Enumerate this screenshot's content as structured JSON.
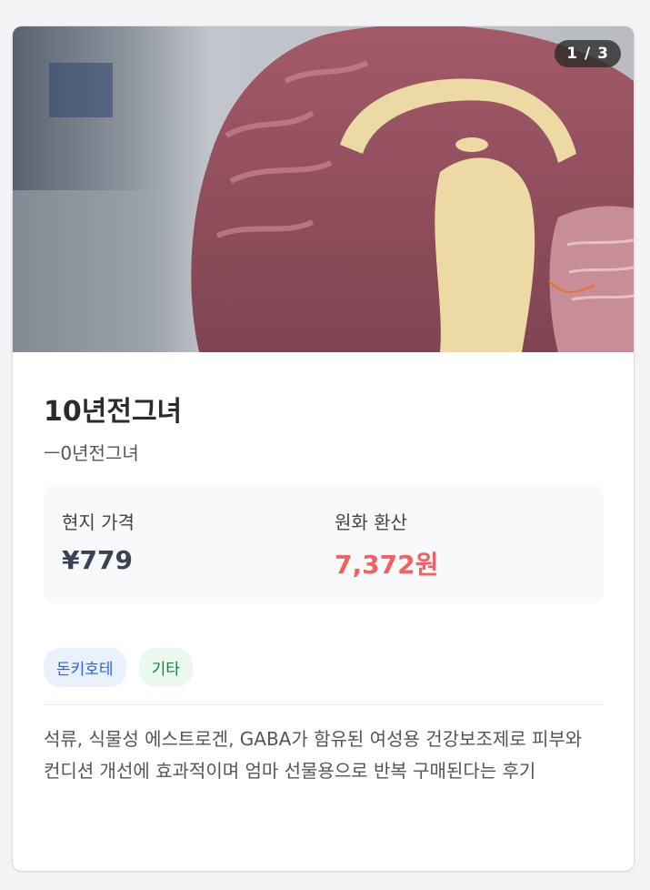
{
  "carousel": {
    "counter": "1 / 3"
  },
  "product": {
    "title": "10년전그녀",
    "subtitle": "ㅡ0년전그녀",
    "local_price_label": "현지 가격",
    "local_price": "¥779",
    "converted_label": "원화 환산",
    "converted_price": "7,372원",
    "tags": [
      "돈키호테",
      "기타"
    ],
    "description": "석류, 식물성 에스트로겐, GABA가 함유된 여성용 건강보조제로 피부와 컨디션 개선에 효과적이며 엄마 선물용으로 반복 구매된다는 후기"
  },
  "colors": {
    "converted_price": "#f06262",
    "store_tag_bg": "#e9f1ff",
    "store_tag_text": "#2563eb",
    "category_tag_bg": "#ebf9ee",
    "category_tag_text": "#17803d"
  }
}
